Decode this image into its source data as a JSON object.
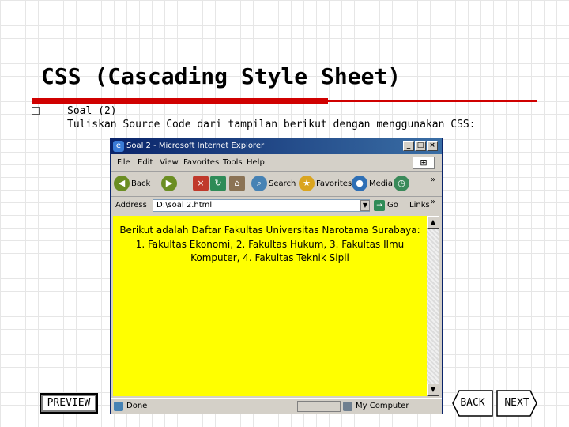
{
  "slide": {
    "title": "CSS (Cascading Style Sheet)",
    "item_line1": "Soal (2)",
    "item_line2": "Tuliskan Source Code dari tampilan berikut dengan menggunakan CSS:"
  },
  "browser": {
    "title": "Soal 2 - Microsoft Internet Explorer",
    "menu": [
      "File",
      "Edit",
      "View",
      "Favorites",
      "Tools",
      "Help"
    ],
    "toolbar": {
      "back": "Back",
      "search": "Search",
      "favorites": "Favorites",
      "media": "Media",
      "more": "»"
    },
    "address": {
      "label": "Address",
      "value": "D:\\soal 2.html",
      "go": "Go",
      "links": "Links"
    },
    "content_text": "Berikut adalah Daftar Fakultas Universitas Narotama Surabaya: 1. Fakultas Ekonomi, 2. Fakultas Hukum, 3. Fakultas Ilmu Komputer, 4. Fakultas Teknik Sipil",
    "content_bg": "#ffff00",
    "status_left": "Done",
    "status_right": "My Computer"
  },
  "nav": {
    "preview": "PREVIEW",
    "back": "BACK",
    "next": "NEXT"
  },
  "colors": {
    "accent": "#d00000",
    "titlebar": "#0a246a"
  }
}
